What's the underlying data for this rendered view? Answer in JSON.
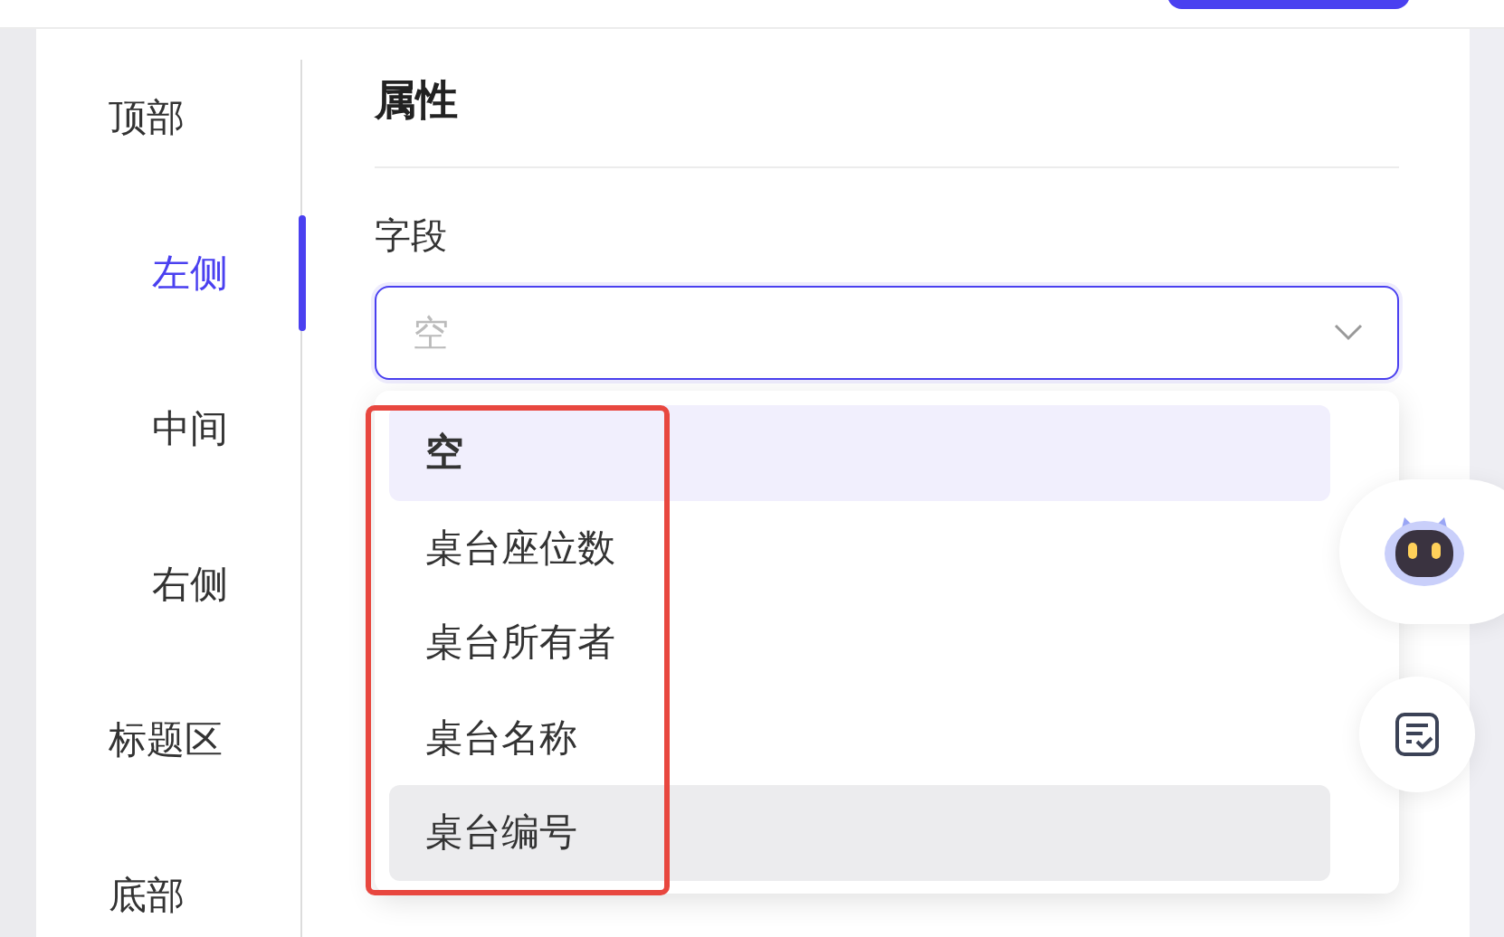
{
  "sidebar": {
    "items": [
      {
        "label": "顶部",
        "kind": "group",
        "selected": false
      },
      {
        "label": "左侧",
        "kind": "sub",
        "selected": true
      },
      {
        "label": "中间",
        "kind": "sub",
        "selected": false
      },
      {
        "label": "右侧",
        "kind": "sub",
        "selected": false
      },
      {
        "label": "标题区",
        "kind": "group",
        "selected": false
      },
      {
        "label": "底部",
        "kind": "group",
        "selected": false
      }
    ]
  },
  "panel": {
    "title": "属性",
    "field": {
      "label": "字段",
      "placeholder": "空"
    },
    "dropdown": {
      "options": [
        {
          "label": "空",
          "selected": true,
          "hovered": false
        },
        {
          "label": "桌台座位数",
          "selected": false,
          "hovered": false
        },
        {
          "label": "桌台所有者",
          "selected": false,
          "hovered": false
        },
        {
          "label": "桌台名称",
          "selected": false,
          "hovered": false
        },
        {
          "label": "桌台编号",
          "selected": false,
          "hovered": true
        }
      ]
    }
  }
}
